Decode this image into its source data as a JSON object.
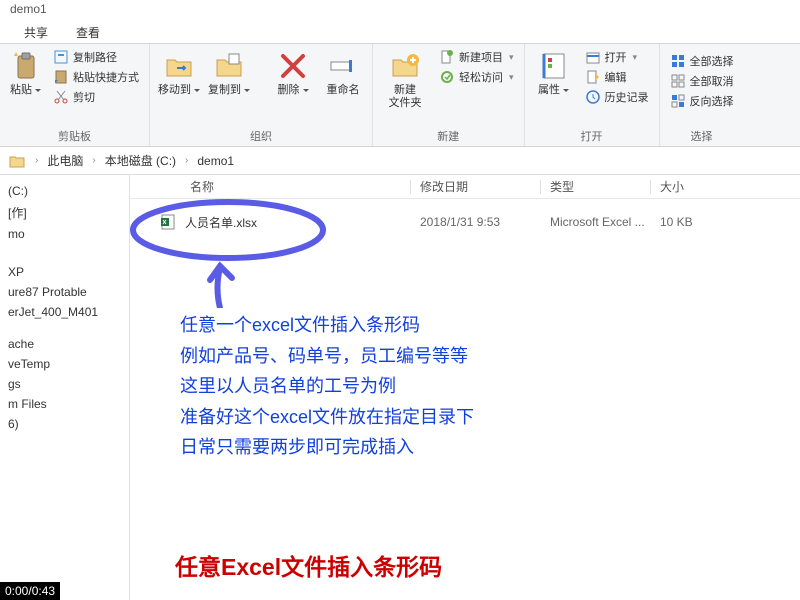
{
  "window": {
    "title": "demo1"
  },
  "tabs": {
    "share": "共享",
    "view": "查看"
  },
  "ribbon": {
    "clipboard": {
      "paste": "粘贴",
      "copy_path": "复制路径",
      "paste_shortcut": "粘贴快捷方式",
      "cut": "剪切",
      "label": "剪贴板"
    },
    "organize": {
      "move_to": "移动到",
      "copy_to": "复制到",
      "delete": "删除",
      "rename": "重命名",
      "label": "组织"
    },
    "new": {
      "new_folder": "新建\n文件夹",
      "new_item": "新建项目",
      "easy_access": "轻松访问",
      "label": "新建"
    },
    "open": {
      "properties": "属性",
      "open": "打开",
      "edit": "编辑",
      "history": "历史记录",
      "label": "打开"
    },
    "select": {
      "select_all": "全部选择",
      "select_none": "全部取消",
      "invert": "反向选择",
      "label": "选择"
    }
  },
  "breadcrumbs": [
    "此电脑",
    "本地磁盘 (C:)",
    "demo1"
  ],
  "columns": {
    "name": "名称",
    "date": "修改日期",
    "type": "类型",
    "size": "大小"
  },
  "file": {
    "name": "人员名单.xlsx",
    "date": "2018/1/31 9:53",
    "type": "Microsoft Excel ...",
    "size": "10 KB"
  },
  "sidebar": {
    "items": [
      "(C:)",
      "[作]",
      "mo",
      "",
      "",
      "",
      "XP",
      "ure87 Protable",
      "erJet_400_M401",
      "",
      "",
      "ache",
      "veTemp",
      "gs",
      "m Files",
      "6)"
    ]
  },
  "annotation": {
    "line1": "任意一个excel文件插入条形码",
    "line2": "例如产品号、码单号，员工编号等等",
    "line3": "这里以人员名单的工号为例",
    "line4": "准备好这个excel文件放在指定目录下",
    "line5": "日常只需要两步即可完成插入"
  },
  "bottom": "任意Excel文件插入条形码",
  "video": "0:00/0:43"
}
